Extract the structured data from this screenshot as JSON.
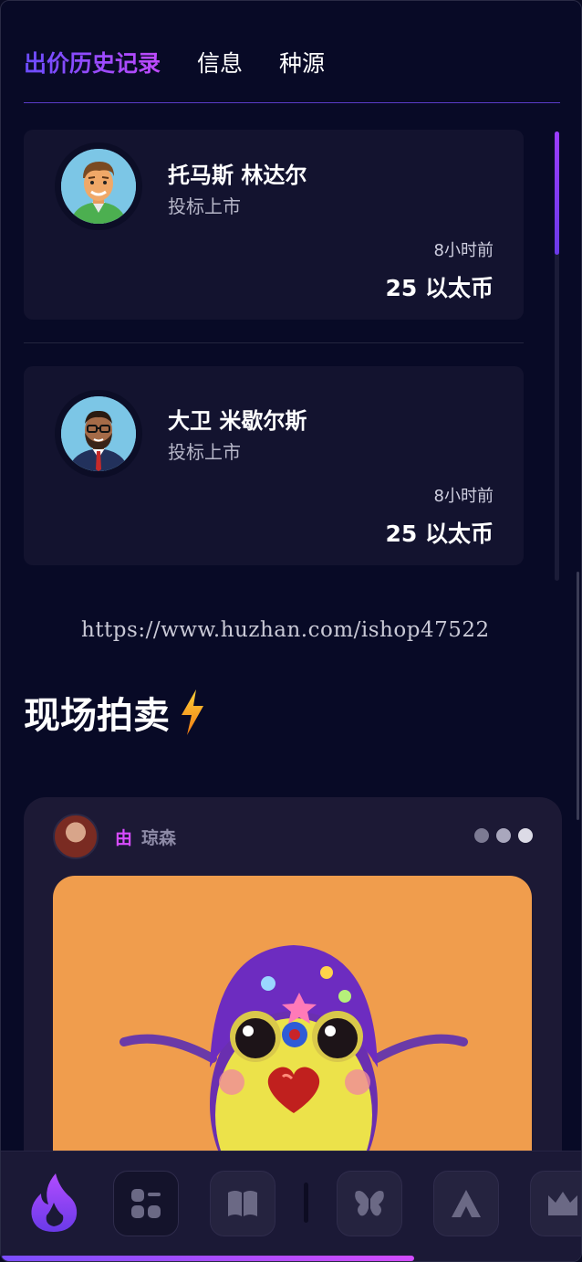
{
  "tabs": [
    {
      "label": "出价历史记录",
      "active": true
    },
    {
      "label": "信息",
      "active": false
    },
    {
      "label": "种源",
      "active": false
    }
  ],
  "bids": [
    {
      "name": "托马斯 林达尔",
      "action": "投标上市",
      "time": "8小时前",
      "amount": "25 以太币",
      "avatar": "man-orange-shirt-avatar"
    },
    {
      "name": "大卫 米歇尔斯",
      "action": "投标上市",
      "time": "8小时前",
      "amount": "25 以太币",
      "avatar": "man-suit-glasses-avatar"
    }
  ],
  "watermark": "https://www.huzhan.com/ishop47522",
  "live_auction": {
    "title": "现场拍卖",
    "title_icon": "lightning-bolt-icon",
    "by_label": "由",
    "creator": "琼森",
    "more_dots_colors": [
      "#7c7a93",
      "#a9a7bd",
      "#dcdbe6"
    ],
    "art_background": "#f09d4d"
  },
  "dock": {
    "items": [
      "flame-logo-icon",
      "dashboard-icon",
      "book-icon",
      "butterfly-icon",
      "a-triangle-icon",
      "crown-icon"
    ],
    "progress_fraction": 0.71
  },
  "colors": {
    "accent": "#8c4dff",
    "accent_pink": "#d84cff",
    "card": "#13132f",
    "bg": "#080a26"
  }
}
